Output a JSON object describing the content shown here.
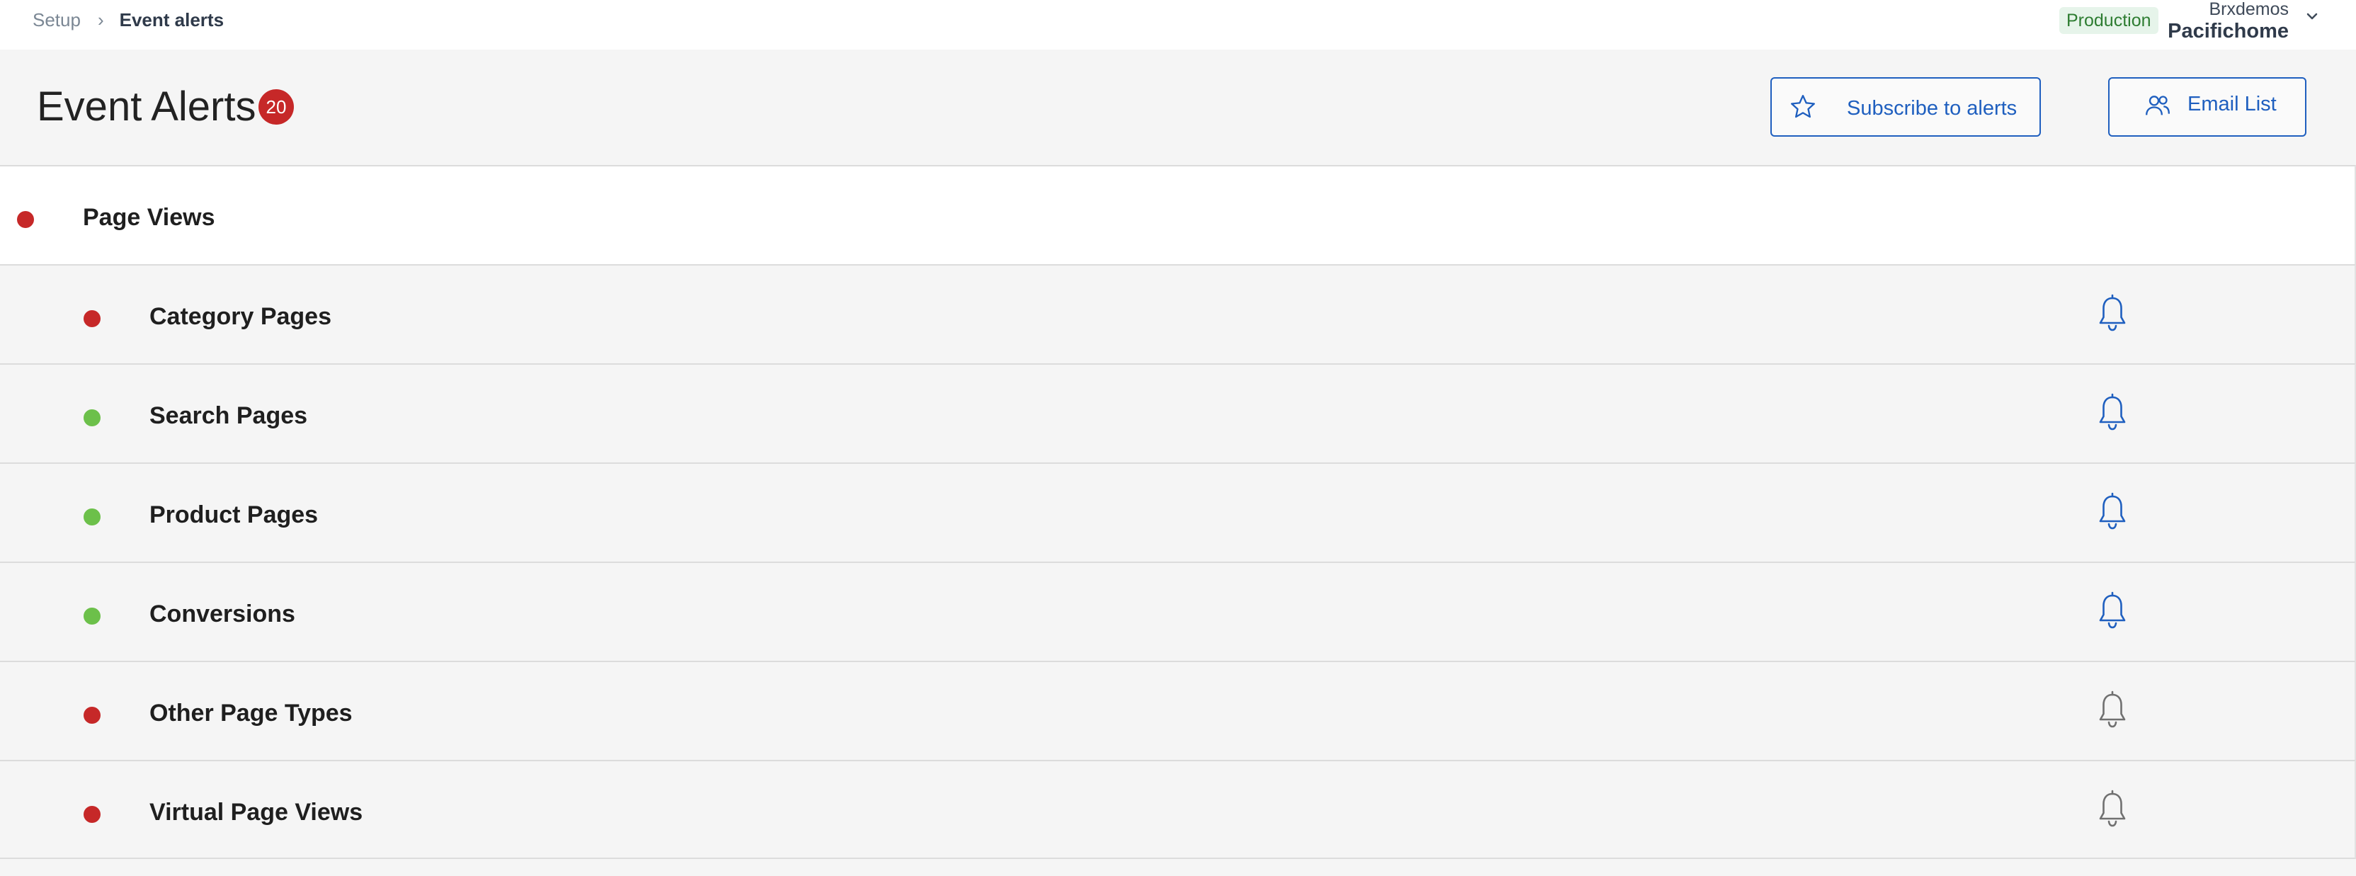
{
  "breadcrumb": {
    "parent": "Setup",
    "separator": "›",
    "current": "Event alerts"
  },
  "environment": "Production",
  "account": {
    "org": "Brxdemos",
    "name": "Pacifichome"
  },
  "header": {
    "title": "Event Alerts",
    "alert_count": "20",
    "subscribe_label": "Subscribe to alerts",
    "email_label": "Email List"
  },
  "colors": {
    "accent": "#1f5fbf",
    "alert_red": "#c62828",
    "ok_green": "#6cc04a",
    "bell_active": "#1f5fbf",
    "bell_inactive": "#707070"
  },
  "rows": [
    {
      "label": "Page Views",
      "status": "red",
      "level": "parent",
      "bell": "none"
    },
    {
      "label": "Category Pages",
      "status": "red",
      "level": "child",
      "bell": "active"
    },
    {
      "label": "Search Pages",
      "status": "green",
      "level": "child",
      "bell": "active"
    },
    {
      "label": "Product Pages",
      "status": "green",
      "level": "child",
      "bell": "active"
    },
    {
      "label": "Conversions",
      "status": "green",
      "level": "child",
      "bell": "active"
    },
    {
      "label": "Other Page Types",
      "status": "red",
      "level": "child",
      "bell": "inactive"
    },
    {
      "label": "Virtual Page Views",
      "status": "red",
      "level": "child",
      "bell": "inactive"
    }
  ]
}
